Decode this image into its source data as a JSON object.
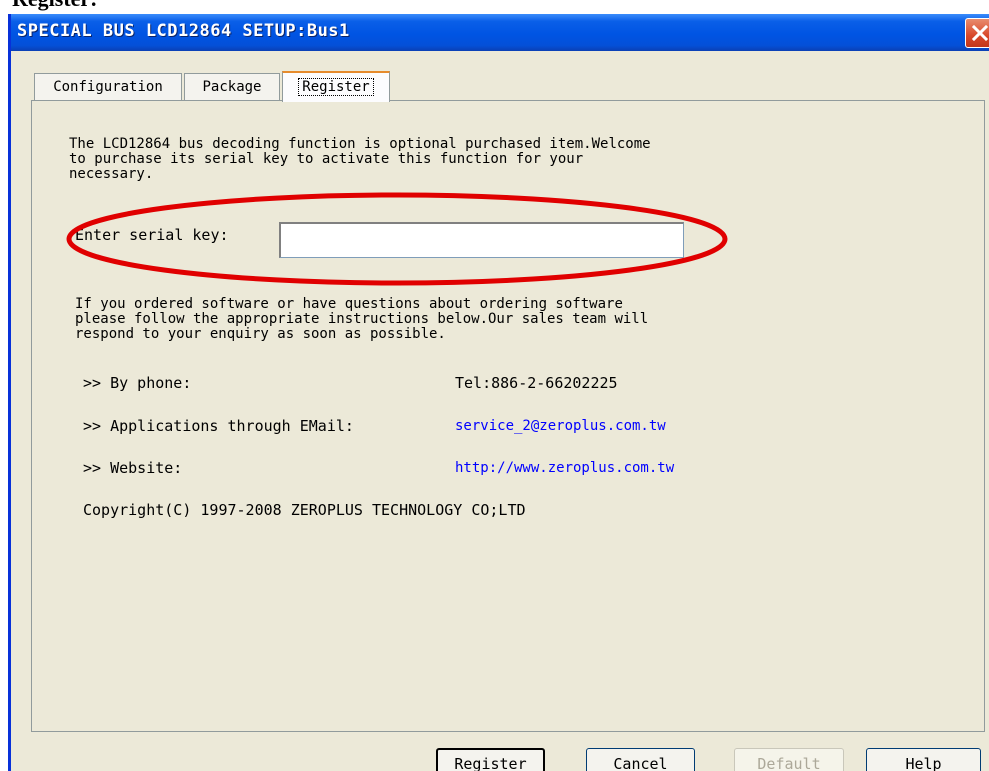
{
  "doc_heading": "Register:",
  "window": {
    "title": "SPECIAL BUS LCD12864 SETUP:Bus1"
  },
  "tabs": [
    {
      "label": "Configuration",
      "active": false
    },
    {
      "label": "Package",
      "active": false
    },
    {
      "label": "Register",
      "active": true
    }
  ],
  "register": {
    "intro_text": "The LCD12864 bus decoding function is optional purchased item.Welcome\nto purchase its serial key to activate this function for your\nnecessary.",
    "serial_key_label": "Enter serial key:",
    "serial_key_value": "",
    "ordering_text": "If you ordered software or have questions about ordering software\nplease follow the appropriate instructions below.Our sales team will\nrespond to your enquiry as soon as possible.",
    "contacts": [
      {
        "label": ">> By phone:",
        "value": "Tel:886-2-66202225",
        "is_link": false
      },
      {
        "label": ">> Applications through EMail:",
        "value": "service_2@zeroplus.com.tw",
        "is_link": true
      },
      {
        "label": ">> Website:",
        "value": "http://www.zeroplus.com.tw",
        "is_link": true
      }
    ],
    "copyright": "Copyright(C) 1997-2008 ZEROPLUS TECHNOLOGY CO;LTD"
  },
  "buttons": {
    "register": "Register",
    "cancel": "Cancel",
    "default": "Default",
    "help": "Help"
  },
  "colors": {
    "titlebar": "#0054e3",
    "annotation": "#e00000",
    "link": "#0000ff",
    "dialog_bg": "#ece9d8"
  }
}
